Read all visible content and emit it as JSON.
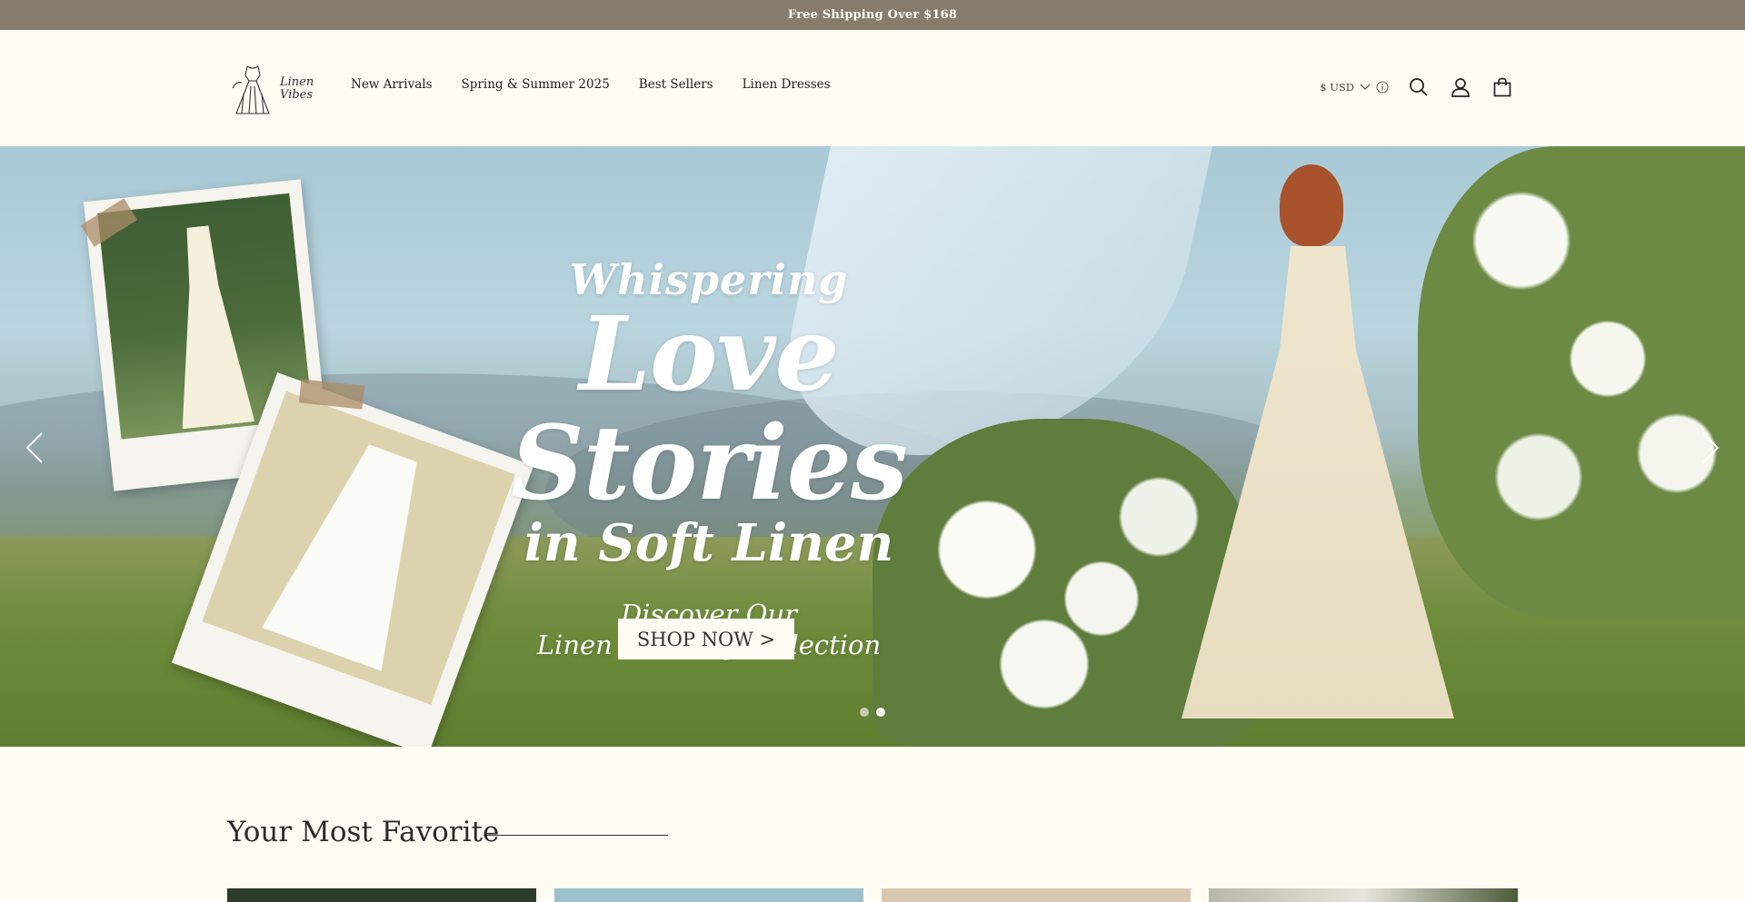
{
  "announcement": {
    "text": "Free Shipping Over $168"
  },
  "header": {
    "logo_text_line1": "Linen",
    "logo_text_line2": "Vibes",
    "nav": [
      {
        "label": "New Arrivals"
      },
      {
        "label": "Spring & Summer 2025"
      },
      {
        "label": "Best Sellers"
      },
      {
        "label": "Linen Dresses"
      }
    ],
    "currency": "$ USD"
  },
  "hero": {
    "line1": "Whispering",
    "line2": "Love Stories",
    "line3": "in Soft Linen",
    "sub1": "Discover Our",
    "sub2": "Linen Wedding Collection",
    "button": "SHOP NOW >",
    "slides_total": 2,
    "slide_active": 2
  },
  "favorites": {
    "title": "Your Most Favorite"
  },
  "colors": {
    "announce_bg": "#877b6e",
    "page_bg": "#fffdf3"
  }
}
